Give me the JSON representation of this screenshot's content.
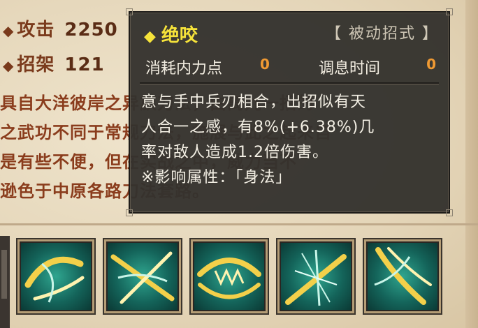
{
  "stats": [
    {
      "label": "攻击",
      "value": "2250"
    },
    {
      "label": "招架",
      "value": "121"
    }
  ],
  "description_behind": [
    "具自大洋彼岸之异族刀法，由离九一招的",
    "之武功不同于常规刀法，施展与此之起来自",
    "是有些不便，但在实战之中，威力当不",
    "逊色于中原各路刀法套路。"
  ],
  "tooltip": {
    "title": "绝咬",
    "type": "【 被动招式 】",
    "cost_label": "消耗内力点",
    "cost_value": "0",
    "cooldown_label": "调息时间",
    "cooldown_value": "0",
    "description": [
      "意与手中兵刃相合，出招似有天",
      "人合一之感，有8%(+6.38%)几",
      "率对敌人造成1.2倍伤害。",
      "※影响属性：「身法」"
    ]
  },
  "skills": [
    {
      "icon": "slash-swirl-icon"
    },
    {
      "icon": "slash-cross-icon"
    },
    {
      "icon": "slash-bite-icon"
    },
    {
      "icon": "slash-burst-icon"
    },
    {
      "icon": "slash-sweep-icon"
    }
  ],
  "colors": {
    "title_yellow": "#f6e33a",
    "value_orange": "#f09a33",
    "stat_brown": "#7a3a1c",
    "tooltip_bg": "#34322e"
  }
}
